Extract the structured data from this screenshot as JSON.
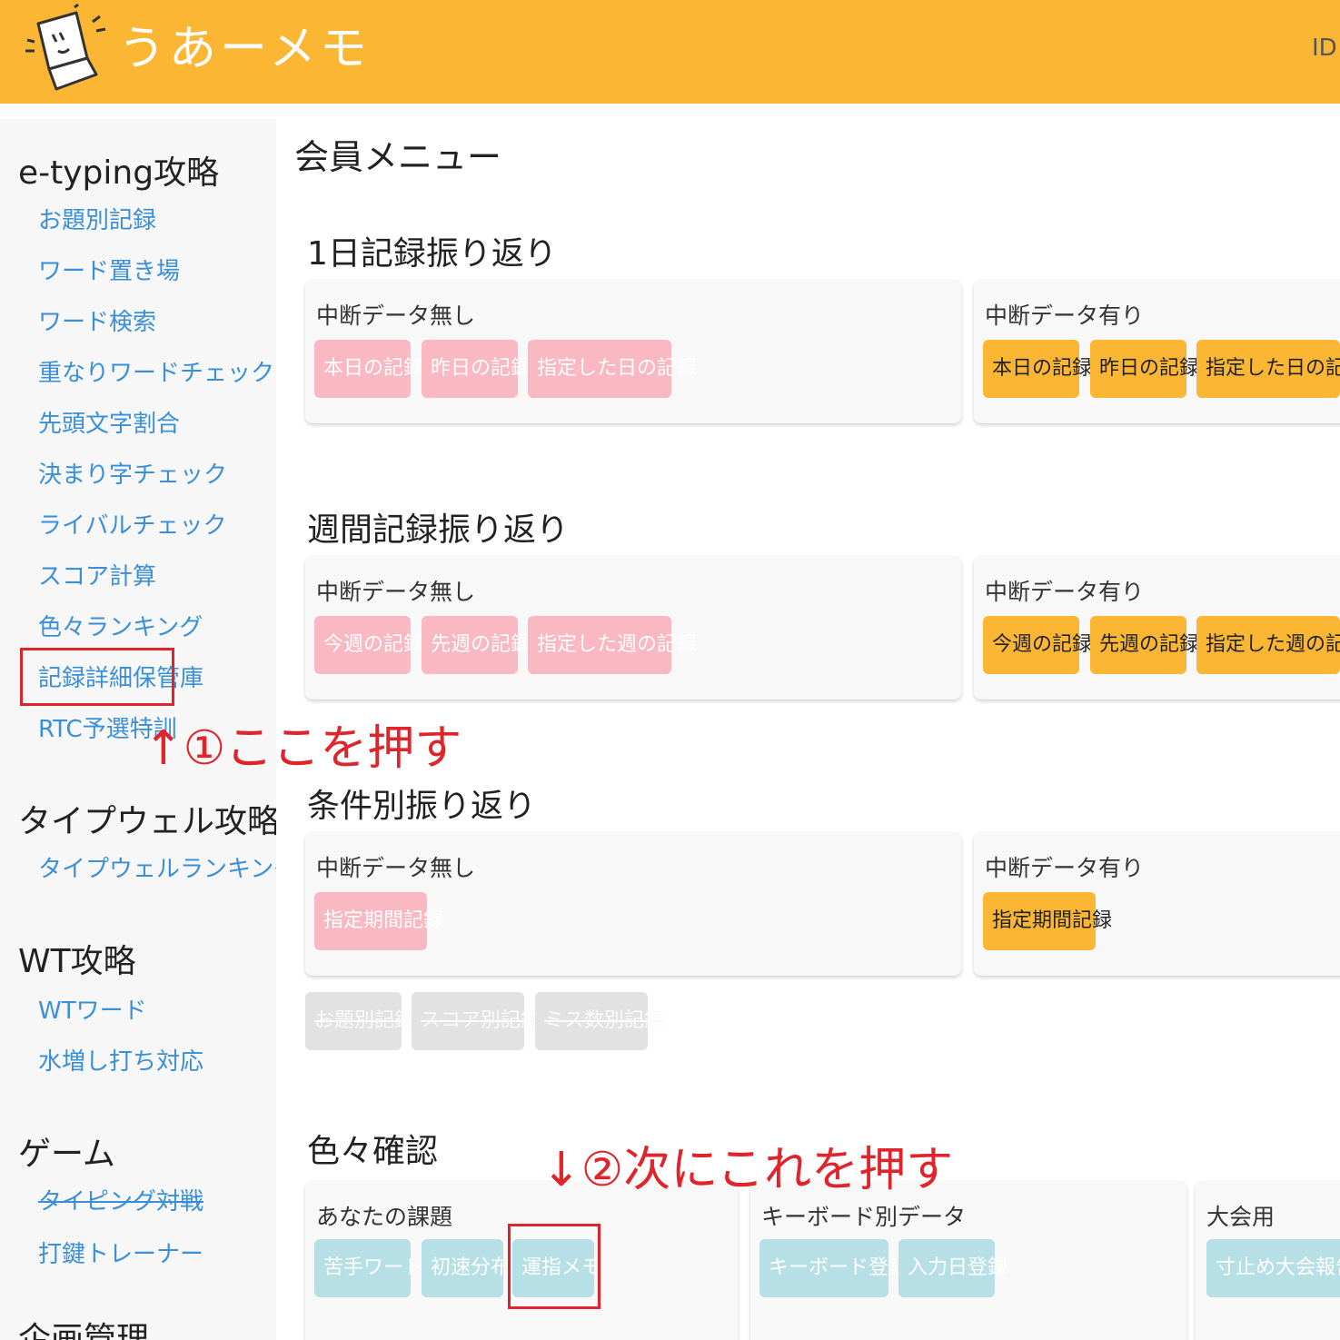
{
  "header": {
    "site_title": "うあーメモ",
    "user_id": "ID :"
  },
  "sidebar": {
    "sections": [
      {
        "title": "e-typing攻略",
        "items": [
          "お題別記録",
          "ワード置き場",
          "ワード検索",
          "重なりワードチェック",
          "先頭文字割合",
          "決まり字チェック",
          "ライバルチェック",
          "スコア計算",
          "色々ランキング",
          "記録詳細保管庫",
          "RTC予選特訓"
        ]
      },
      {
        "title": "タイプウェル攻略",
        "items": [
          "タイプウェルランキング"
        ]
      },
      {
        "title": "WT攻略",
        "items": [
          "WTワード",
          "水増し打ち対応"
        ]
      },
      {
        "title": "ゲーム",
        "items": [
          "タイピング対戦",
          "打鍵トレーナー"
        ]
      },
      {
        "title": "企画管理",
        "items": []
      }
    ]
  },
  "main": {
    "page_title": "会員メニュー",
    "daily": {
      "title": "1日記録振り返り",
      "no_interrupt": {
        "label": "中断データ無し",
        "buttons": [
          "本日の記録",
          "昨日の記録",
          "指定した日の記録"
        ]
      },
      "with_interrupt": {
        "label": "中断データ有り",
        "buttons": [
          "本日の記録",
          "昨日の記録",
          "指定した日の記録"
        ]
      }
    },
    "weekly": {
      "title": "週間記録振り返り",
      "no_interrupt": {
        "label": "中断データ無し",
        "buttons": [
          "今週の記録",
          "先週の記録",
          "指定した週の記録"
        ]
      },
      "with_interrupt": {
        "label": "中断データ有り",
        "buttons": [
          "今週の記録",
          "先週の記録",
          "指定した週の記録"
        ]
      }
    },
    "conditional": {
      "title": "条件別振り返り",
      "no_interrupt": {
        "label": "中断データ無し",
        "buttons": [
          "指定期間記録"
        ]
      },
      "with_interrupt": {
        "label": "中断データ有り",
        "buttons": [
          "指定期間記録"
        ]
      },
      "disabled_buttons": [
        "お題別記録",
        "スコア別記録",
        "ミス数別記録"
      ]
    },
    "misc": {
      "title": "色々確認",
      "tasks": {
        "label": "あなたの課題",
        "buttons": [
          "苦手ワード",
          "初速分布",
          "運指メモ"
        ]
      },
      "keyboard": {
        "label": "キーボード別データ",
        "buttons": [
          "キーボード登録",
          "入力日登録"
        ]
      },
      "tournament": {
        "label": "大会用",
        "buttons": [
          "寸止め大会報告記"
        ]
      }
    }
  },
  "annotations": {
    "step1": "↑①ここを押す",
    "step2": "↓②次にこれを押す"
  },
  "colors": {
    "header": "#fbb634",
    "accent_red": "#e0242b",
    "link": "#3a8fd9"
  }
}
